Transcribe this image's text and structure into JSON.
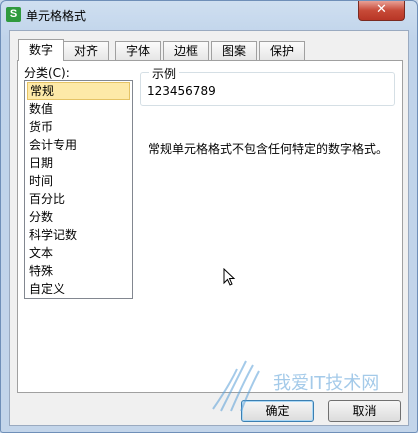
{
  "window": {
    "title": "单元格格式",
    "app_icon_letter": "S",
    "close_glyph": "✕"
  },
  "tabs": [
    {
      "label": "数字",
      "active": true
    },
    {
      "label": "对齐",
      "active": false
    },
    {
      "label": "字体",
      "active": false
    },
    {
      "label": "边框",
      "active": false
    },
    {
      "label": "图案",
      "active": false
    },
    {
      "label": "保护",
      "active": false
    }
  ],
  "category": {
    "label": "分类(C):",
    "items": [
      "常规",
      "数值",
      "货币",
      "会计专用",
      "日期",
      "时间",
      "百分比",
      "分数",
      "科学记数",
      "文本",
      "特殊",
      "自定义"
    ],
    "selected_index": 0
  },
  "sample": {
    "legend": "示例",
    "value": "123456789"
  },
  "description": "常规单元格格式不包含任何特定的数字格式。",
  "buttons": {
    "ok": "确定",
    "cancel": "取消"
  },
  "watermark_text": "我爱IT技术网",
  "colors": {
    "selection_bg": "#fde9a8",
    "close_red": "#c74a38",
    "app_icon_green": "#2f9a3e"
  }
}
